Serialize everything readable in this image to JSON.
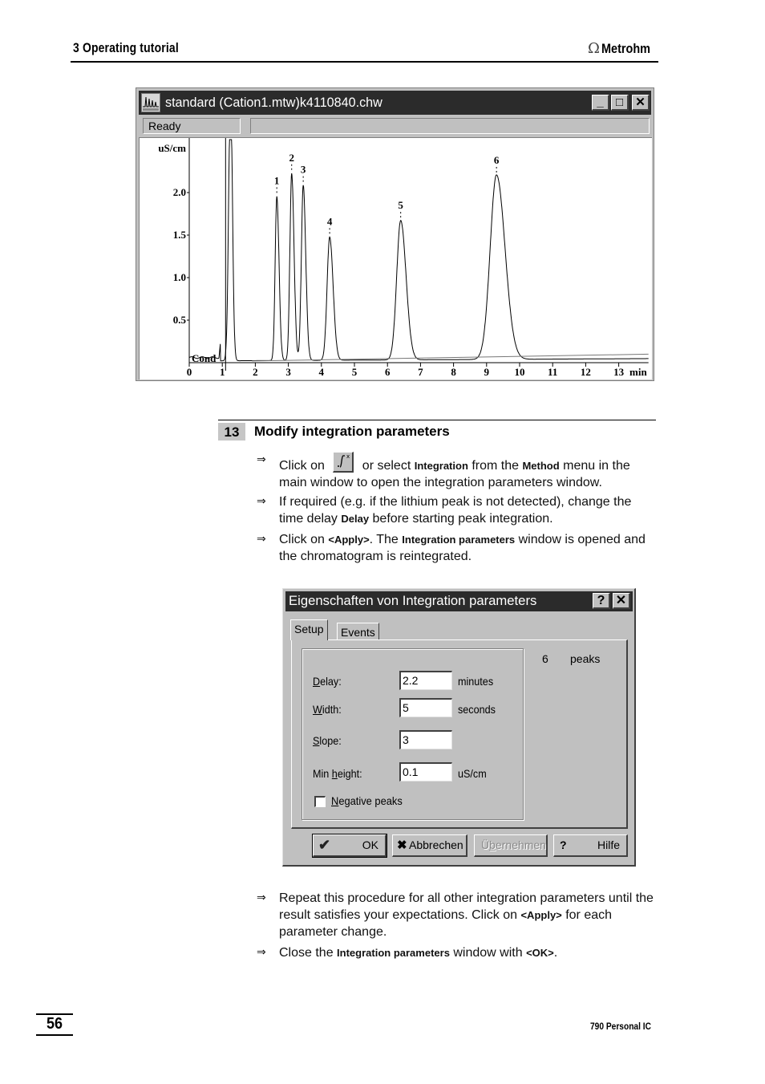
{
  "header": {
    "chapter": "3  Operating tutorial",
    "brand": "Metrohm",
    "brand_icon": "omega-logo-icon"
  },
  "chromatogram_window": {
    "title": "standard (Cation1.mtw)k4110840.chw",
    "app_icon": "chromatogram-app-icon",
    "controls": {
      "minimize": "_",
      "maximize": "□",
      "close": "✕"
    },
    "status": "Ready",
    "status_secondary": ""
  },
  "chart_data": {
    "type": "line",
    "title": "",
    "xlabel": "min",
    "ylabel": "uS/cm",
    "channel_label": "Cond",
    "xlim": [
      0,
      13.9
    ],
    "ylim": [
      0,
      2.6
    ],
    "x_ticks": [
      0,
      1,
      2,
      3,
      4,
      5,
      6,
      7,
      8,
      9,
      10,
      11,
      12,
      13
    ],
    "y_ticks": [
      0.5,
      1.0,
      1.5,
      2.0
    ],
    "y_tick_labels": [
      "0.5",
      "1.0",
      "1.5",
      "2.0"
    ],
    "grid": false,
    "baseline_offset": 0.06,
    "injection_marker_min": 1.1,
    "system_peak": {
      "time_min": 1.25,
      "height": 3.2,
      "note": "off-scale"
    },
    "peaks": [
      {
        "label": "1",
        "time_min": 2.65,
        "height": 1.93,
        "width_min": 0.07
      },
      {
        "label": "2",
        "time_min": 3.1,
        "height": 2.2,
        "width_min": 0.075
      },
      {
        "label": "3",
        "time_min": 3.45,
        "height": 2.06,
        "width_min": 0.08
      },
      {
        "label": "4",
        "time_min": 4.25,
        "height": 1.45,
        "width_min": 0.11
      },
      {
        "label": "5",
        "time_min": 6.4,
        "height": 1.64,
        "width_min": 0.17
      },
      {
        "label": "6",
        "time_min": 9.3,
        "height": 2.17,
        "width_min": 0.27
      }
    ]
  },
  "step": {
    "number": "13",
    "title": "Modify integration parameters",
    "bullets": [
      {
        "parts": [
          "Click on ",
          "{icon}",
          " or select ",
          "Integration",
          " from the ",
          "Method",
          " menu in the main window to open the integration parameters window."
        ],
        "icon": "integration-toolbar-icon"
      },
      {
        "parts": [
          "If required (e.g. if the lithium peak is not detected), change the time delay ",
          "Delay",
          " before starting peak integration."
        ]
      },
      {
        "parts": [
          "Click on ",
          "<Apply>",
          ". The ",
          "Integration parameters",
          " window is opened and the chromatogram is reintegrated."
        ]
      }
    ],
    "bullets_after": [
      {
        "parts": [
          "Repeat this procedure for all other integration parameters until the result satisfies your expectations. Click on ",
          "<Apply>",
          " for each parameter change."
        ]
      },
      {
        "parts": [
          "Close the ",
          "Integration parameters",
          " window with ",
          "<OK>",
          "."
        ]
      }
    ],
    "arrow": "⇒"
  },
  "dialog": {
    "title": "Eigenschaften von Integration parameters",
    "help_btn": "?",
    "close_btn": "✕",
    "tabs": [
      {
        "label": "Setup",
        "active": true
      },
      {
        "label": "Events",
        "active": false
      }
    ],
    "fields": [
      {
        "label_pre": "",
        "label_u": "D",
        "label_post": "elay:",
        "value": "2.2",
        "unit": "minutes"
      },
      {
        "label_pre": "",
        "label_u": "W",
        "label_post": "idth:",
        "value": "5",
        "unit": "seconds"
      },
      {
        "label_pre": "",
        "label_u": "S",
        "label_post": "lope:",
        "value": "3",
        "unit": ""
      },
      {
        "label_pre": "Min ",
        "label_u": "h",
        "label_post": "eight:",
        "value": "0.1",
        "unit": "uS/cm"
      }
    ],
    "negative_peaks": {
      "label_u": "N",
      "label_post": "egative peaks",
      "checked": false
    },
    "peaks_count": "6",
    "peaks_label": "peaks",
    "buttons": {
      "ok": "OK",
      "cancel": "Abbrechen",
      "apply_u": "Ü",
      "apply_u2": "b",
      "apply_post": "ernehmen",
      "help": "Hilfe",
      "help_glyph": "?"
    }
  },
  "footer": {
    "page_number": "56",
    "product": "790 Personal IC"
  }
}
